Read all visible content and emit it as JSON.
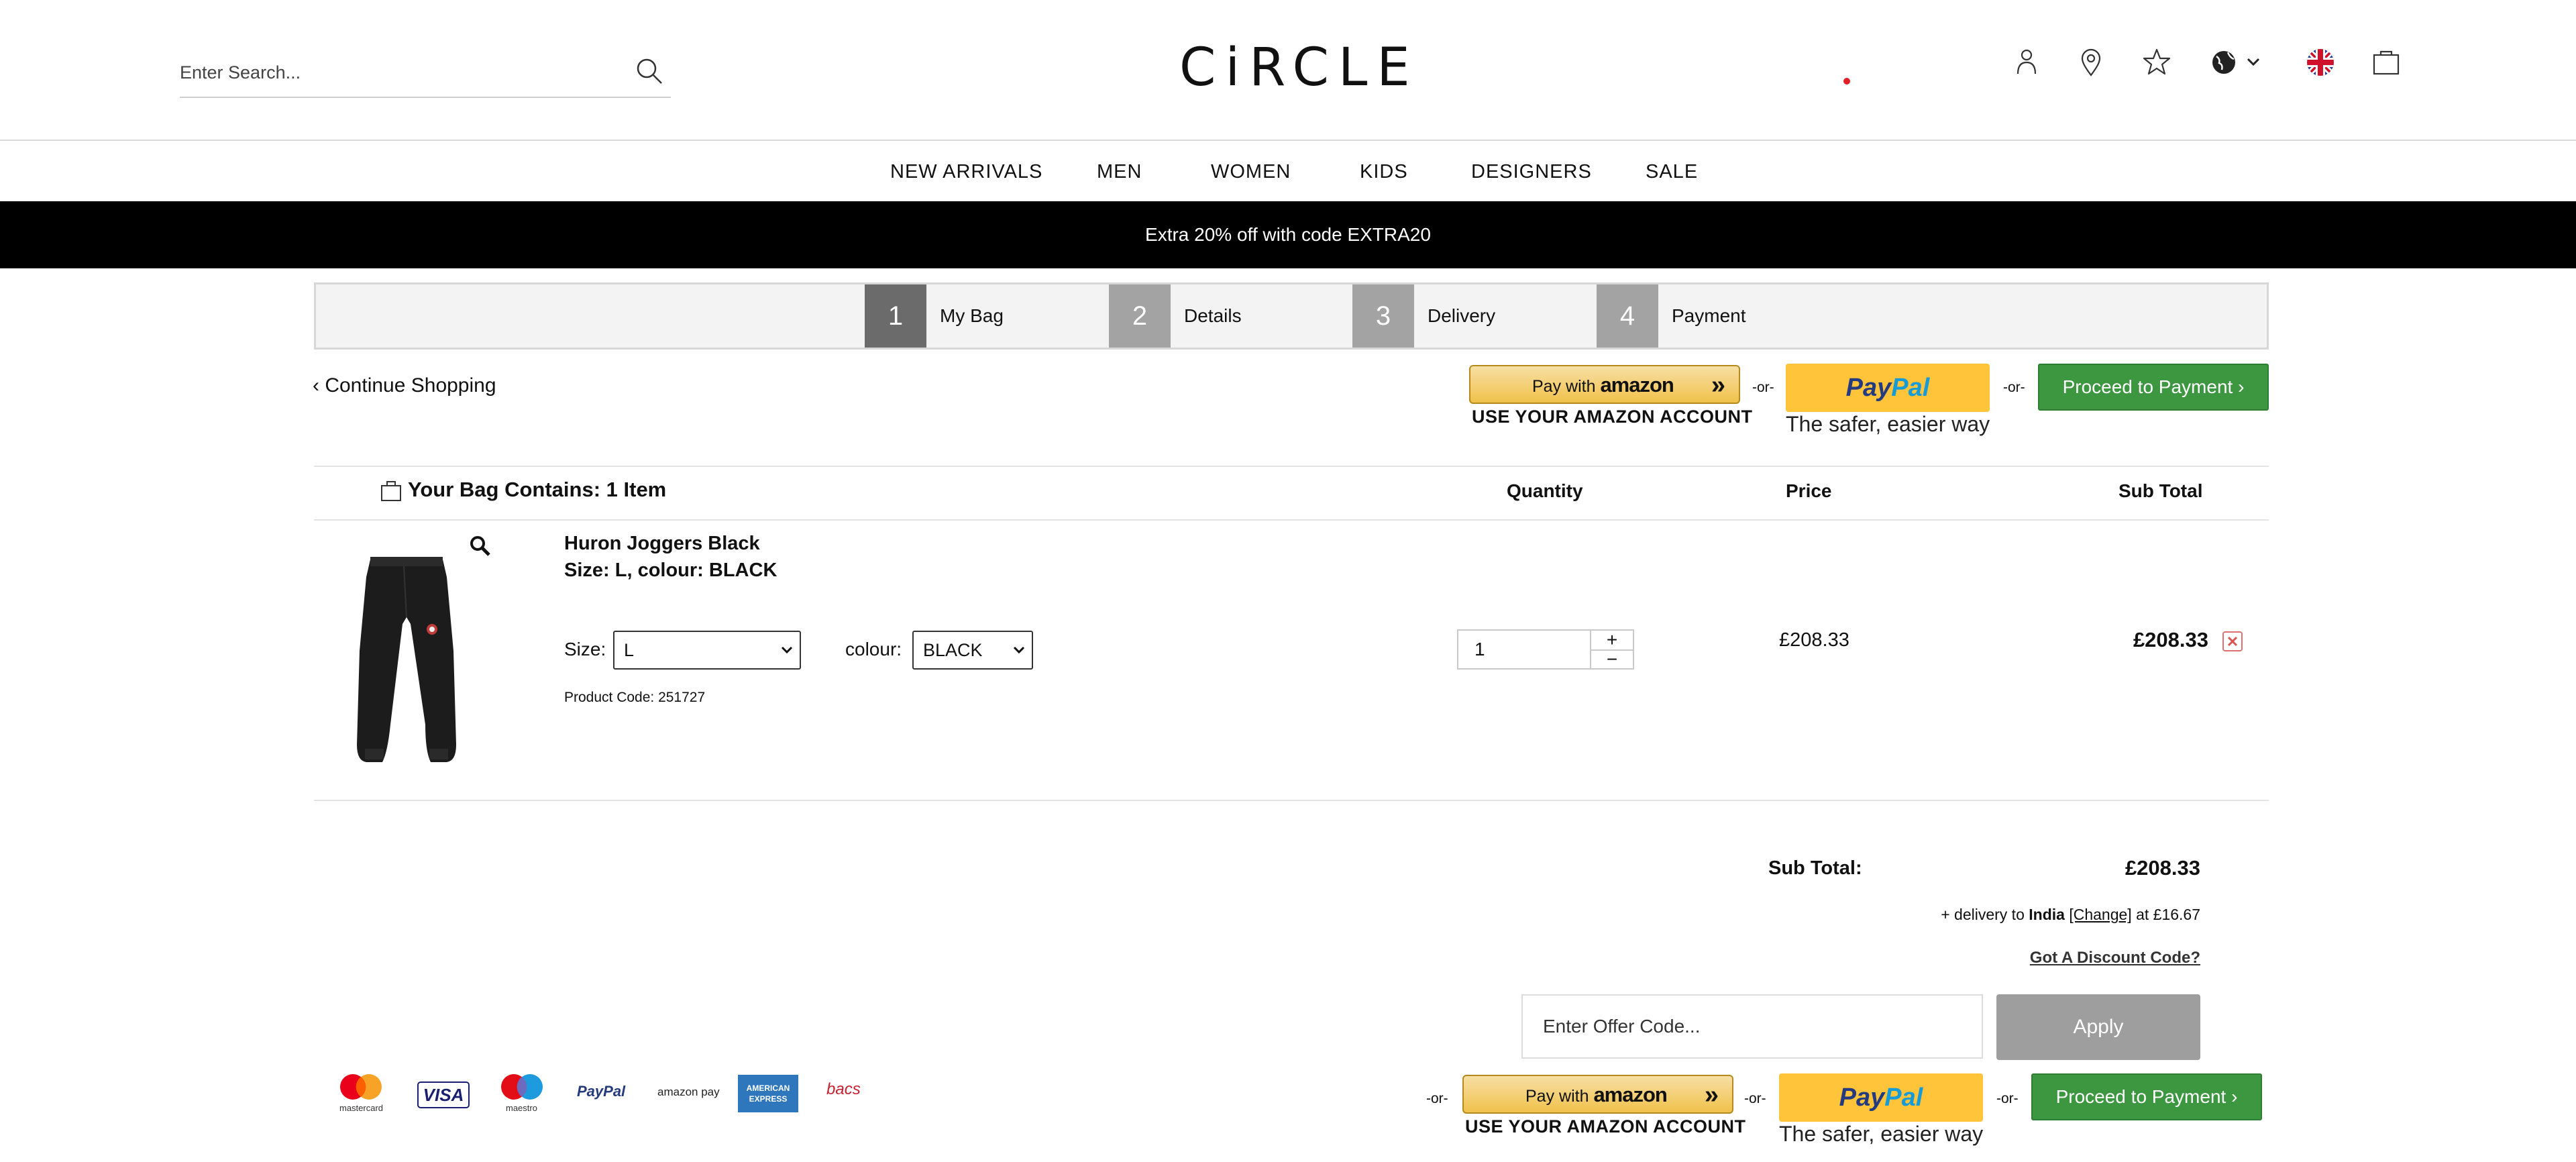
{
  "header": {
    "search_placeholder": "Enter Search...",
    "logo": "CiRCLE",
    "icons": [
      "account-icon",
      "store-locator-icon",
      "wishlist-icon",
      "globe-icon",
      "uk-flag-icon",
      "bag-icon"
    ]
  },
  "nav": {
    "items": [
      "NEW ARRIVALS",
      "MEN",
      "WOMEN",
      "KIDS",
      "DESIGNERS",
      "SALE"
    ]
  },
  "promo": {
    "text": "Extra 20% off with code EXTRA20"
  },
  "steps": [
    {
      "num": "1",
      "label": "My Bag",
      "active": true
    },
    {
      "num": "2",
      "label": "Details",
      "active": false
    },
    {
      "num": "3",
      "label": "Delivery",
      "active": false
    },
    {
      "num": "4",
      "label": "Payment",
      "active": false
    }
  ],
  "actions": {
    "continue_shopping": "‹ Continue Shopping",
    "amazon_pay_with": "Pay with",
    "amazon_brand": "amazon",
    "amazon_caption": "USE YOUR AMAZON ACCOUNT",
    "or": "-or-",
    "paypal_pay": "Pay",
    "paypal_pal": "Pal",
    "paypal_caption": "The safer, easier way",
    "proceed": "Proceed to Payment ›"
  },
  "bag": {
    "heading": "Your Bag Contains: 1 Item",
    "columns": {
      "quantity": "Quantity",
      "price": "Price",
      "subtotal": "Sub Total"
    },
    "item": {
      "name": "Huron Joggers Black",
      "variant": "Size: L, colour: BLACK",
      "size_label": "Size:",
      "size_value": "L",
      "colour_label": "colour:",
      "colour_value": "BLACK",
      "product_code": "Product Code: 251727",
      "quantity": "1",
      "plus": "+",
      "minus": "−",
      "price": "£208.33",
      "subtotal": "£208.33"
    }
  },
  "totals": {
    "subtotal_label": "Sub Total:",
    "subtotal_value": "£208.33",
    "delivery_prefix": "+ delivery to",
    "delivery_country": "India",
    "delivery_change": "[Change]",
    "delivery_suffix": "at £16.67",
    "discount_link": "Got A Discount Code?",
    "offer_placeholder": "Enter Offer Code...",
    "apply": "Apply"
  },
  "payment_logos": {
    "mastercard": "mastercard",
    "visa": "VISA",
    "maestro": "maestro",
    "paypal": "PayPal",
    "amazonpay": "amazon pay",
    "amex_1": "AMERICAN",
    "amex_2": "EXPRESS",
    "bacs": "bacs"
  },
  "colors": {
    "proceed_green": "#3d9741",
    "paypal_yellow": "#ffc439",
    "step_active": "#6b6b6b",
    "step_inactive": "#a3a3a3",
    "apply_grey": "#9e9e9e"
  }
}
